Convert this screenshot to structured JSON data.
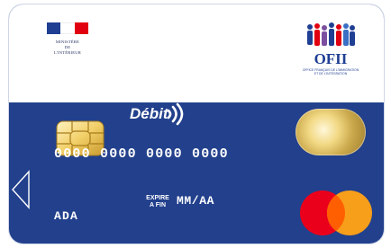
{
  "card": {
    "type_label": "Débit",
    "number": "0000 0000 0000 0000",
    "expire_label": "EXPIRE\nA FIN",
    "expire_value": "MM/AA",
    "holder": "ADA"
  },
  "issuer_left": {
    "text": "MINISTÈRE\nDE\nL'INTÉRIEUR",
    "flag_colors": [
      "#1f3f93",
      "#ffffff",
      "#e1000f"
    ]
  },
  "issuer_right": {
    "name": "OFII",
    "subtitle": "OFFICE FRANÇAIS DE L'IMMIGRATION\nET DE L'INTÉGRATION"
  },
  "colors": {
    "card_blue": "#22408c",
    "mastercard_red": "#eb001b",
    "mastercard_orange": "#f79e1b",
    "mastercard_overlap": "#ff5f00"
  },
  "icons": [
    "chip-icon",
    "contactless-icon",
    "hologram-icon",
    "mastercard-logo",
    "left-arrow-icon"
  ]
}
